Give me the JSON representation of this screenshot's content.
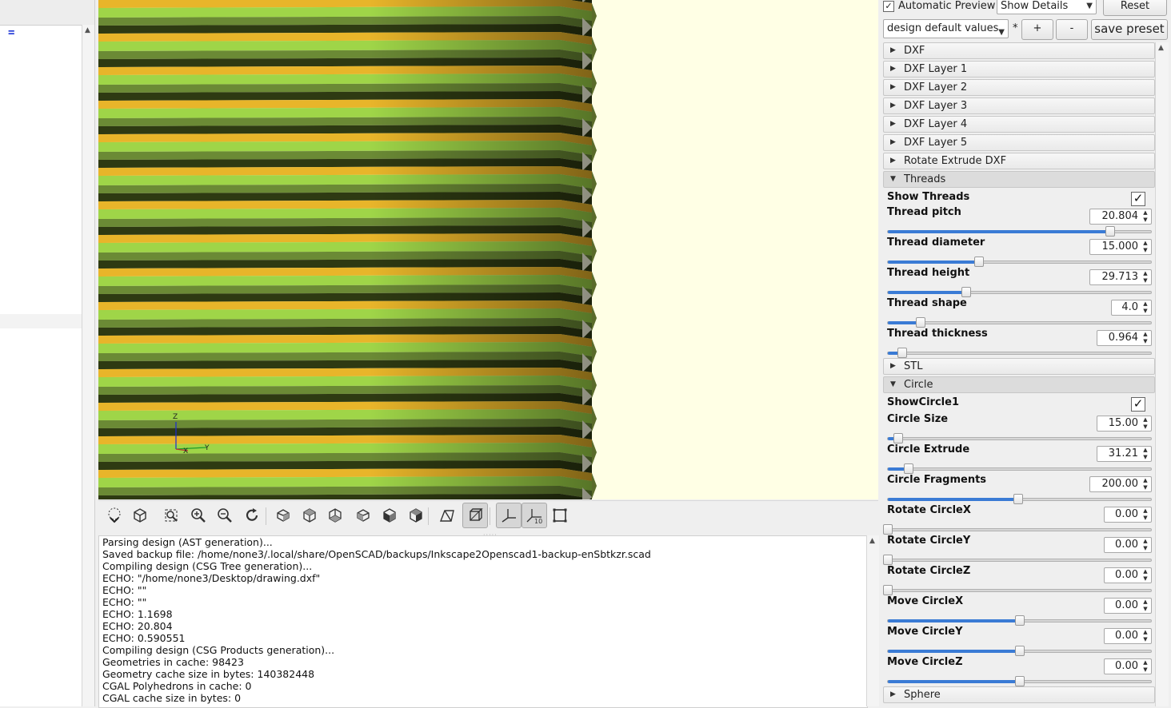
{
  "editor": {
    "code_line": "="
  },
  "viewport": {
    "axis_label_z": "Z",
    "axis_label_x": "X",
    "axis_label_y": "Y",
    "stripe_colors": [
      "#e8b52a",
      "#9fd548",
      "#6b8a35",
      "#2e3a12"
    ]
  },
  "toolbar": {
    "buttons": [
      {
        "name": "preview-icon"
      },
      {
        "name": "render-icon"
      },
      {
        "name": "view-all-icon"
      },
      {
        "name": "zoom-in-icon"
      },
      {
        "name": "zoom-out-icon"
      },
      {
        "name": "reset-view-icon"
      },
      {
        "name": "view-right-icon"
      },
      {
        "name": "view-top-icon"
      },
      {
        "name": "view-bottom-icon"
      },
      {
        "name": "view-left-icon"
      },
      {
        "name": "view-front-icon"
      },
      {
        "name": "view-back-icon"
      },
      {
        "name": "perspective-icon"
      },
      {
        "name": "orthogonal-icon"
      },
      {
        "name": "show-axes-icon"
      },
      {
        "name": "show-scale-markers-icon"
      },
      {
        "name": "show-edges-icon"
      }
    ]
  },
  "console": {
    "lines": [
      "Parsing design (AST generation)...",
      "Saved backup file: /home/none3/.local/share/OpenSCAD/backups/Inkscape2Openscad1-backup-enSbtkzr.scad",
      "Compiling design (CSG Tree generation)...",
      "ECHO: \"/home/none3/Desktop/drawing.dxf\"",
      "ECHO: \"\"",
      "ECHO: \"\"",
      "ECHO: 1.1698",
      "ECHO: 20.804",
      "ECHO: 0.590551",
      "Compiling design (CSG Products generation)...",
      "Geometries in cache: 98423",
      "Geometry cache size in bytes: 140382448",
      "CGAL Polyhedrons in cache: 0",
      "CGAL cache size in bytes: 0"
    ]
  },
  "customizer": {
    "automatic_preview_label": "Automatic Preview",
    "automatic_preview_checked": "✓",
    "details_combo": "Show Details",
    "reset_label": "Reset",
    "preset_combo": "design default values",
    "preset_modified": "*",
    "add_preset_label": "+",
    "remove_preset_label": "-",
    "save_preset_label": "save preset",
    "groups_collapsed_top": [
      "DXF",
      "DXF Layer 1",
      "DXF Layer 2",
      "DXF Layer 3",
      "DXF Layer 4",
      "DXF Layer 5",
      "Rotate Extrude DXF"
    ],
    "threads": {
      "title": "Threads",
      "show_label": "Show Threads",
      "show_checked": "✓",
      "params": [
        {
          "label": "Thread pitch",
          "value": "20.804",
          "level": 0.845
        },
        {
          "label": "Thread diameter",
          "value": "15.000",
          "level": 0.345
        },
        {
          "label": "Thread height",
          "value": "29.713",
          "level": 0.297
        },
        {
          "label": "Thread shape",
          "value": "4.0",
          "level": 0.125
        },
        {
          "label": "Thread thickness",
          "value": "0.964",
          "level": 0.055
        }
      ]
    },
    "stl_title": "STL",
    "circle": {
      "title": "Circle",
      "show_label": "ShowCircle1",
      "show_checked": "✓",
      "params": [
        {
          "label": "Circle Size",
          "value": "15.00",
          "level": 0.04
        },
        {
          "label": "Circle Extrude",
          "value": "31.21",
          "level": 0.08
        },
        {
          "label": "Circle Fragments",
          "value": "200.00",
          "level": 0.495
        },
        {
          "label": "Rotate CircleX",
          "value": "0.00",
          "level": 0.0
        },
        {
          "label": "Rotate CircleY",
          "value": "0.00",
          "level": 0.0
        },
        {
          "label": "Rotate CircleZ",
          "value": "0.00",
          "level": 0.0
        },
        {
          "label": "Move CircleX",
          "value": "0.00",
          "level": 0.5
        },
        {
          "label": "Move CircleY",
          "value": "0.00",
          "level": 0.5
        },
        {
          "label": "Move CircleZ",
          "value": "0.00",
          "level": 0.5
        }
      ]
    },
    "sphere_title": "Sphere"
  }
}
